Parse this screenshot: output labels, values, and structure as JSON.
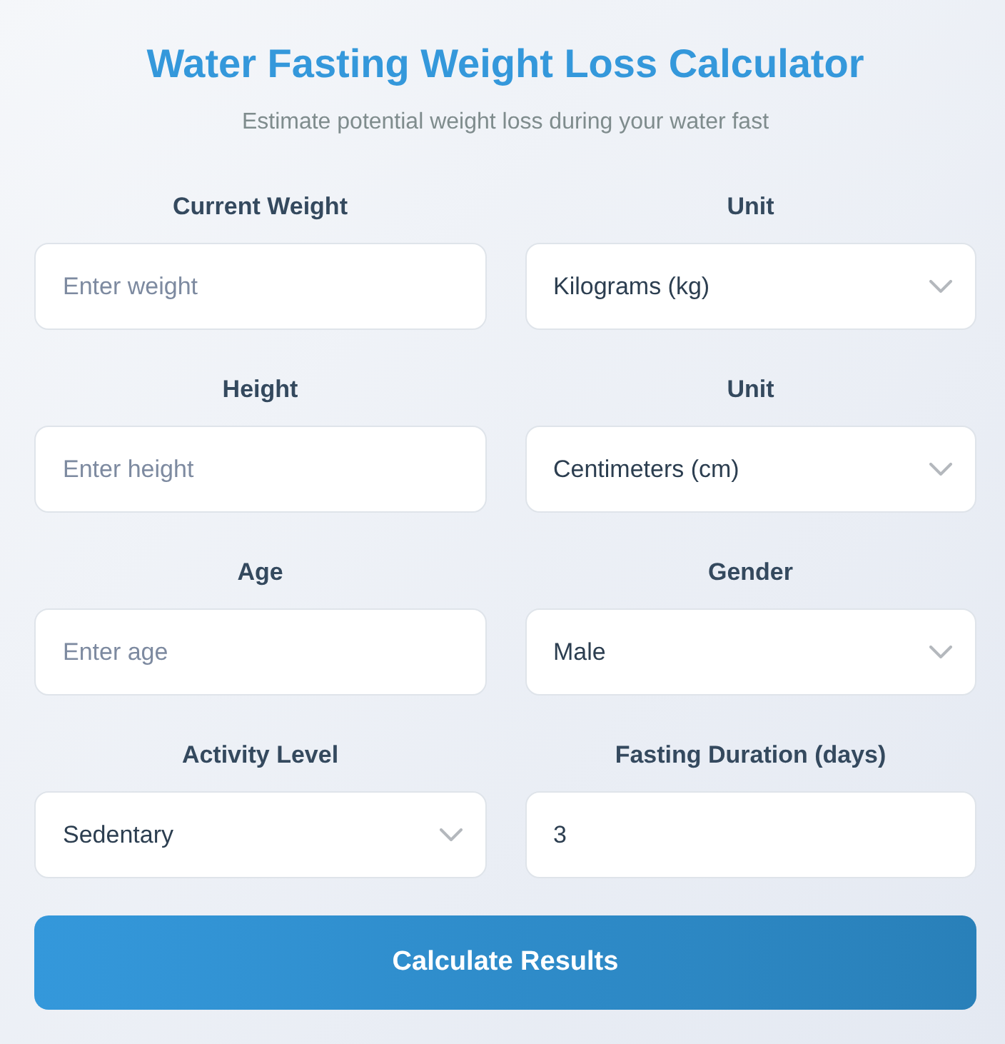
{
  "title": "Water Fasting Weight Loss Calculator",
  "subtitle": "Estimate potential weight loss during your water fast",
  "fields": [
    {
      "kind": "input",
      "label": "Current Weight",
      "placeholder": "Enter weight"
    },
    {
      "kind": "select",
      "label": "Unit",
      "value": "Kilograms (kg)"
    },
    {
      "kind": "input",
      "label": "Height",
      "placeholder": "Enter height"
    },
    {
      "kind": "select",
      "label": "Unit",
      "value": "Centimeters (cm)"
    },
    {
      "kind": "input",
      "label": "Age",
      "placeholder": "Enter age"
    },
    {
      "kind": "select",
      "label": "Gender",
      "value": "Male"
    },
    {
      "kind": "select",
      "label": "Activity Level",
      "value": "Sedentary"
    },
    {
      "kind": "input",
      "label": "Fasting Duration (days)",
      "value": "3"
    }
  ],
  "button": {
    "label": "Calculate Results"
  }
}
